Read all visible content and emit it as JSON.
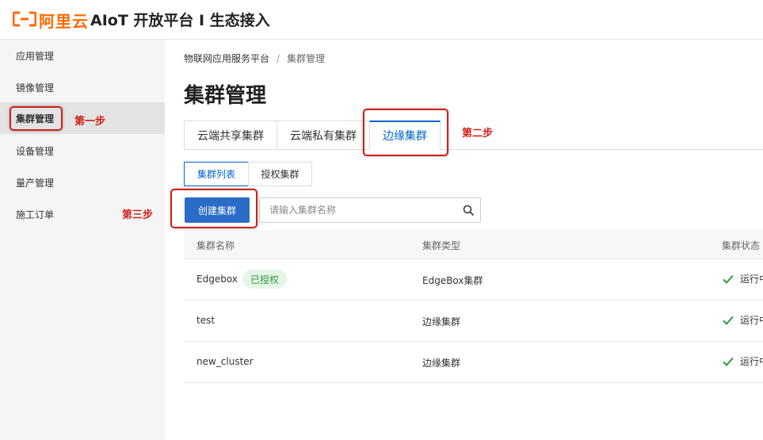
{
  "header": {
    "logo_text": "阿里云",
    "product_title": "AIoT 开放平台 I 生态接入",
    "brand_color": "#ff6a00"
  },
  "sidebar": {
    "items": [
      {
        "label": "应用管理"
      },
      {
        "label": "镜像管理"
      },
      {
        "label": "集群管理",
        "active": true
      },
      {
        "label": "设备管理"
      },
      {
        "label": "量产管理"
      },
      {
        "label": "施工订单"
      }
    ]
  },
  "annotations": {
    "step1": "第一步",
    "step2": "第二步",
    "step3": "第三步",
    "color": "#d0201a"
  },
  "breadcrumb": {
    "root": "物联网应用服务平台",
    "separator": "/",
    "current": "集群管理"
  },
  "page_title": "集群管理",
  "tabs": [
    {
      "label": "云端共享集群"
    },
    {
      "label": "云端私有集群"
    },
    {
      "label": "边缘集群",
      "active": true
    }
  ],
  "subtabs": [
    {
      "label": "集群列表",
      "active": true
    },
    {
      "label": "授权集群"
    }
  ],
  "toolbar": {
    "create_label": "创建集群",
    "search_placeholder": "请输入集群名称",
    "search_icon": "search-icon"
  },
  "table": {
    "columns": [
      "集群名称",
      "集群类型",
      "集群状态"
    ],
    "rows": [
      {
        "name": "Edgebox",
        "badge": "已授权",
        "type": "EdgeBox集群",
        "status": "运行中"
      },
      {
        "name": "test",
        "type": "边缘集群",
        "status": "运行中"
      },
      {
        "name": "new_cluster",
        "type": "边缘集群",
        "status": "运行中"
      }
    ]
  },
  "colors": {
    "primary": "#2b6cc7",
    "tab_active": "#0064c8",
    "success": "#2d9a3e"
  }
}
